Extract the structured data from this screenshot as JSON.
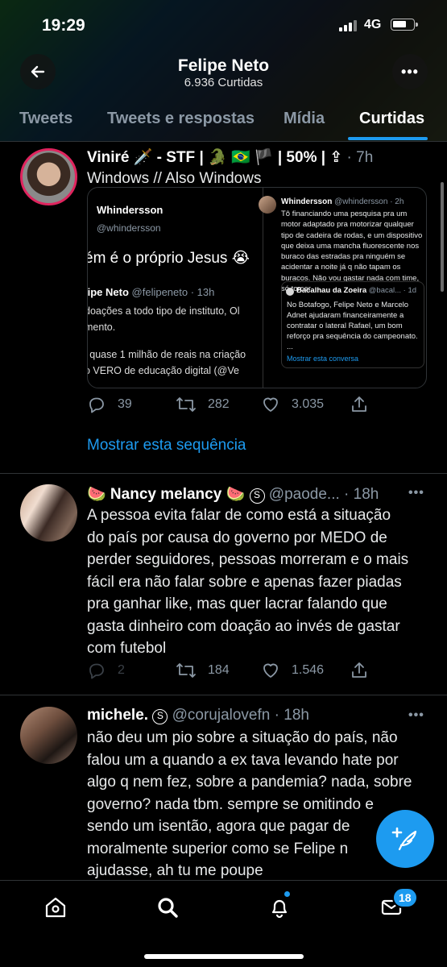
{
  "status_bar": {
    "time": "19:29",
    "network": "4G"
  },
  "header": {
    "name": "Felipe Neto",
    "subtitle": "6.936 Curtidas"
  },
  "tabs": [
    {
      "label": "Tweets"
    },
    {
      "label": "Tweets e respostas"
    },
    {
      "label": "Mídia"
    },
    {
      "label": "Curtidas",
      "active": true
    }
  ],
  "tweets": [
    {
      "author": "Viniré 🗡️ - STF | 🐊 🇧🇷 🏴 | 50% | ⇪ ",
      "meta": "· 7h",
      "text": "Windows // Also Windows",
      "embed": {
        "left": {
          "name": "Whindersson",
          "handle": "@whindersson",
          "big_text": "ém é o próprio Jesus 😭",
          "inner_name": "lipe Neto",
          "inner_handle": "@felipeneto · 13h",
          "lines": [
            "doações a todo tipo de instituto, Ol",
            "mento.",
            "",
            "i quase 1 milhão de reais na criação",
            "o VERO de educação digital (@Ve"
          ]
        },
        "right": {
          "name": "Whindersson",
          "handle": "@whindersson · 2h",
          "text": "Tô financiando uma pesquisa pra um motor adaptado pra motorizar qualquer tipo de cadeira de rodas, e um dispositivo que deixa uma mancha fluorescente nos buraco das estradas pra ninguém se acidentar a noite já q não tapam os buracos. Não vou gastar nada com time, só torcer.",
          "quote_name": "Bacalhau da Zoeira",
          "quote_handle": "@bacal... · 1d",
          "quote_text": "No Botafogo, Felipe Neto e Marcelo Adnet ajudaram financeiramente a contratar o lateral Rafael, um bom reforço pra sequência do campeonato. ...",
          "quote_link": "Mostrar esta conversa"
        }
      },
      "replies": "39",
      "retweets": "282",
      "likes": "3.035",
      "show_thread": "Mostrar esta sequência"
    },
    {
      "author": "🍉 Nancy melancy 🍉",
      "handle": "@paode...",
      "meta": "· 18h",
      "text": "A pessoa evita falar de como está a situação do país por causa do governo por MEDO de perder seguidores, pessoas morreram e o mais fácil era não falar sobre e apenas fazer piadas pra ganhar like, mas quer lacrar falando que gasta dinheiro com doação ao invés de gastar com futebol",
      "replies": "2",
      "retweets": "184",
      "likes": "1.546"
    },
    {
      "author": "michele.",
      "handle": "@corujalovefn",
      "meta": "· 18h",
      "text": "não deu um pio sobre a situação do país, não falou um a quando a ex tava levando hate por algo q nem fez, sobre a pandemia? nada, sobre governo? nada tbm. sempre se omitindo e sendo um isentão, agora que pagar de moralmente superior como se Felipe n ajudasse, ah tu me poupe"
    }
  ],
  "bottom_nav": {
    "messages_badge": "18"
  },
  "colors": {
    "accent": "#1d9bf0",
    "background": "#000000",
    "muted": "#8b98a5"
  }
}
